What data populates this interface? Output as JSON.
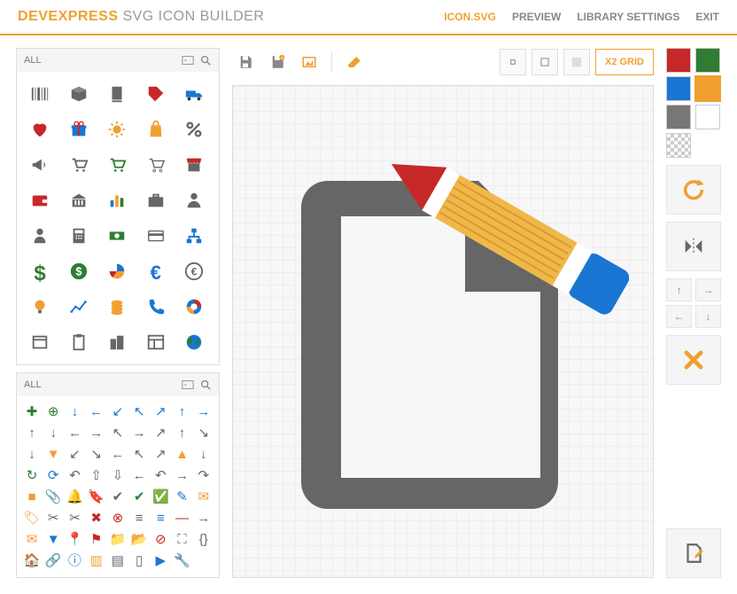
{
  "brand": {
    "p1": "DEVEXPRESS",
    "p2": "SVG ICON BUILDER"
  },
  "nav": {
    "icon": "ICON.SVG",
    "preview": "PREVIEW",
    "library": "LIBRARY SETTINGS",
    "exit": "EXIT"
  },
  "panel1": {
    "title": "ALL"
  },
  "panel2": {
    "title": "ALL"
  },
  "toolbar": {
    "grid": "X2 GRID"
  },
  "colors": {
    "red": "#c62828",
    "green": "#2e7d32",
    "blue": "#1976d2",
    "yellow": "#f0a030",
    "gray": "#777",
    "white": "#fff"
  },
  "chart_data": null
}
